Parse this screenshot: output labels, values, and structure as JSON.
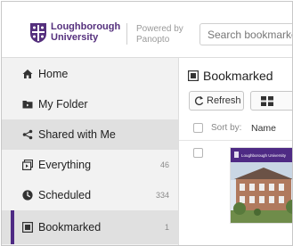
{
  "brand": {
    "line1": "Loughborough",
    "line2": "University",
    "powered_line1": "Powered by",
    "powered_line2": "Panopto",
    "color": "#55307d"
  },
  "search": {
    "placeholder": "Search bookmarked"
  },
  "sidebar": {
    "items": [
      {
        "label": "Home",
        "icon": "home-icon",
        "count": ""
      },
      {
        "label": "My Folder",
        "icon": "folder-icon",
        "count": ""
      },
      {
        "label": "Shared with Me",
        "icon": "share-icon",
        "count": ""
      },
      {
        "label": "Everything",
        "icon": "everything-icon",
        "count": "46"
      },
      {
        "label": "Scheduled",
        "icon": "clock-icon",
        "count": "334"
      },
      {
        "label": "Bookmarked",
        "icon": "bookmark-icon",
        "count": "1"
      }
    ]
  },
  "main": {
    "title": "Bookmarked",
    "refresh_label": "Refresh",
    "sort_by_label": "Sort by:",
    "sort_name_label": "Name",
    "thumbnail_caption": "Loughborough University"
  }
}
